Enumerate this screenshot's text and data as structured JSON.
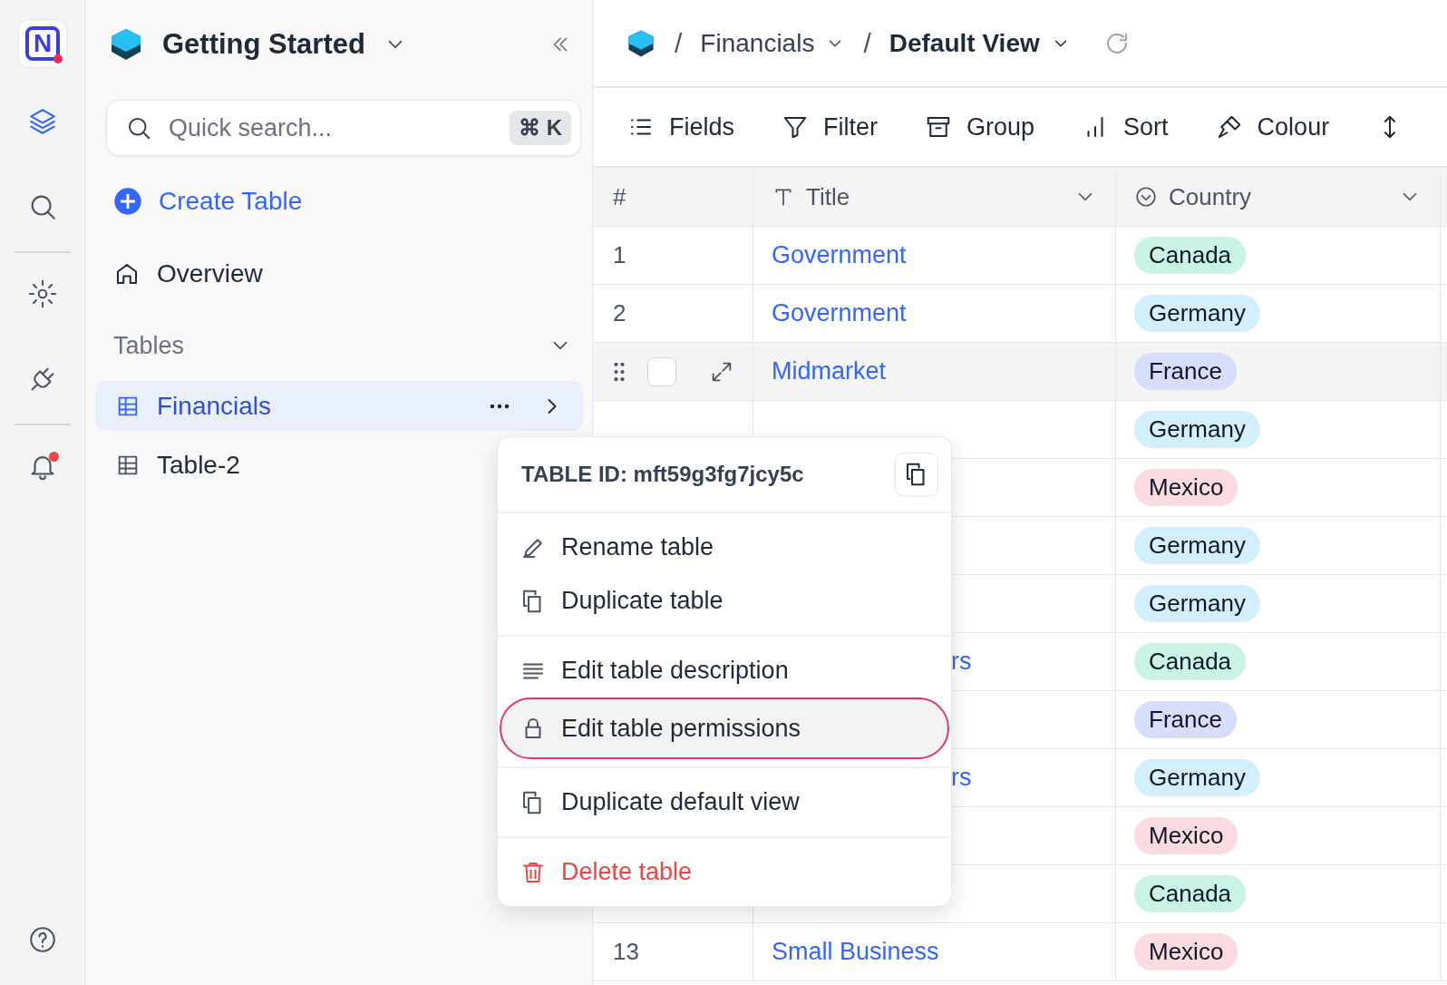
{
  "rail": {
    "logo": "N",
    "items": [
      {
        "kind": "layers",
        "selected": true
      },
      {
        "kind": "search",
        "selected": false
      },
      {
        "kind": "gear",
        "selected": false
      },
      {
        "kind": "plug",
        "selected": false
      },
      {
        "kind": "bell",
        "selected": false,
        "alert": true
      }
    ],
    "help": {
      "kind": "help"
    }
  },
  "sidebar": {
    "title": "Getting Started",
    "search": {
      "placeholder": "Quick search...",
      "shortcut": "⌘ K"
    },
    "create": "Create Table",
    "overview": "Overview",
    "section": "Tables",
    "tables": [
      {
        "label": "Financials",
        "selected": true
      },
      {
        "label": "Table-2",
        "selected": false
      }
    ]
  },
  "breadcrumb": [
    {
      "separator": "/",
      "label": "Financials",
      "selected": false
    },
    {
      "separator": "/",
      "label": "Default View",
      "selected": true
    }
  ],
  "toolbar": [
    {
      "kind": "list",
      "label": "Fields"
    },
    {
      "kind": "filter",
      "label": "Filter"
    },
    {
      "kind": "group",
      "label": "Group"
    },
    {
      "kind": "sort",
      "label": "Sort"
    },
    {
      "kind": "brush",
      "label": "Colour"
    },
    {
      "kind": "rowheight"
    }
  ],
  "table": {
    "columns": [
      {
        "label": "#"
      },
      {
        "label": "Title",
        "kind": "text"
      },
      {
        "label": "Country",
        "kind": "select"
      }
    ],
    "rows": [
      {
        "number": "1",
        "title": "Government",
        "country": {
          "label": "Canada",
          "color": "#c9f4e4"
        }
      },
      {
        "number": "2",
        "title": "Government",
        "country": {
          "label": "Germany",
          "color": "#d2effc"
        }
      },
      {
        "hovered": true,
        "checked": false,
        "title": "Midmarket",
        "country": {
          "label": "France",
          "color": "#d6defc"
        }
      },
      {
        "country": {
          "label": "Germany",
          "color": "#d2effc"
        }
      },
      {
        "country": {
          "label": "Mexico",
          "color": "#fbdbe0"
        }
      },
      {
        "country": {
          "label": "Germany",
          "color": "#d2effc"
        }
      },
      {
        "country": {
          "label": "Germany",
          "color": "#d2effc"
        }
      },
      {
        "title": "rs",
        "covered": true,
        "country": {
          "label": "Canada",
          "color": "#c9f4e4"
        }
      },
      {
        "country": {
          "label": "France",
          "color": "#d6defc"
        }
      },
      {
        "title": "rs",
        "covered": true,
        "country": {
          "label": "Germany",
          "color": "#d2effc"
        }
      },
      {
        "country": {
          "label": "Mexico",
          "color": "#fbdbe0"
        }
      },
      {
        "country": {
          "label": "Canada",
          "color": "#c9f4e4"
        }
      },
      {
        "number": "13",
        "title": "Small Business",
        "country": {
          "label": "Mexico",
          "color": "#fbdbe0"
        }
      }
    ]
  },
  "menu": {
    "header": "TABLE ID: mft59g3fg7jcy5c",
    "sections": [
      [
        {
          "kind": "pencil",
          "label": "Rename table",
          "selected": false,
          "danger": false
        },
        {
          "kind": "copy",
          "label": "Duplicate table",
          "selected": false,
          "danger": false
        }
      ],
      [
        {
          "kind": "lines",
          "label": "Edit table description",
          "selected": false,
          "danger": false
        },
        {
          "kind": "lock",
          "label": "Edit table permissions",
          "selected": true,
          "danger": false
        }
      ],
      [
        {
          "kind": "copy",
          "label": "Duplicate default view",
          "selected": false,
          "danger": false
        }
      ],
      [
        {
          "kind": "trash",
          "label": "Delete table",
          "selected": false,
          "danger": true
        }
      ]
    ]
  }
}
